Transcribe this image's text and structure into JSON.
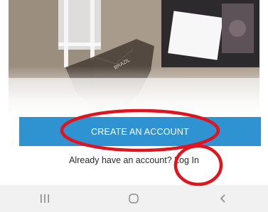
{
  "hero": {
    "map_label": "BRAZIL",
    "icons": [
      "folded-map-image",
      "photograph-image"
    ]
  },
  "actions": {
    "create_account_label": "CREATE AN ACCOUNT",
    "login_prompt_prefix": "Already have an accou",
    "login_prompt_obscured": "nt",
    "login_prompt_suffix": "?",
    "login_link_label": "Log In"
  },
  "navbar": {
    "icons": [
      "recent-apps-icon",
      "home-icon",
      "back-icon"
    ]
  },
  "annotations": {
    "color": "#e0141e",
    "circled": [
      "create-account-button",
      "login-link"
    ]
  },
  "colors": {
    "button": "#2f93d2",
    "button_text": "#ffffff",
    "navbar_bg": "#f1f1f1"
  }
}
